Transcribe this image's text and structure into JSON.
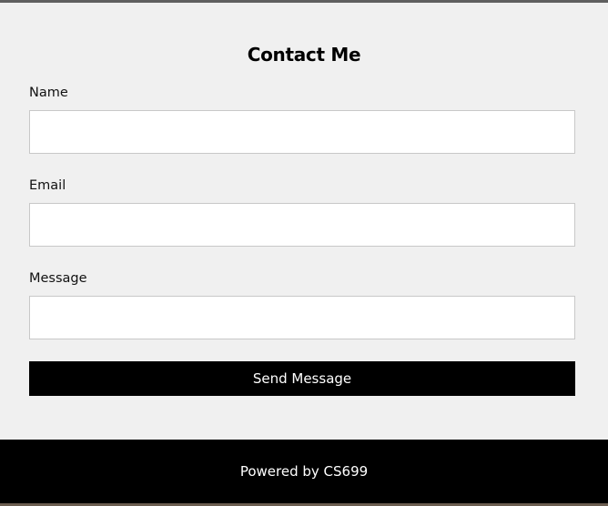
{
  "form": {
    "title": "Contact Me",
    "fields": [
      {
        "label": "Name",
        "value": "",
        "placeholder": ""
      },
      {
        "label": "Email",
        "value": "",
        "placeholder": ""
      },
      {
        "label": "Message",
        "value": "",
        "placeholder": ""
      }
    ],
    "submit_label": "Send Message"
  },
  "footer": {
    "text": "Powered by CS699"
  },
  "colors": {
    "background": "#f0f0f0",
    "button": "#000000",
    "footer": "#000000",
    "text_light": "#ffffff"
  }
}
